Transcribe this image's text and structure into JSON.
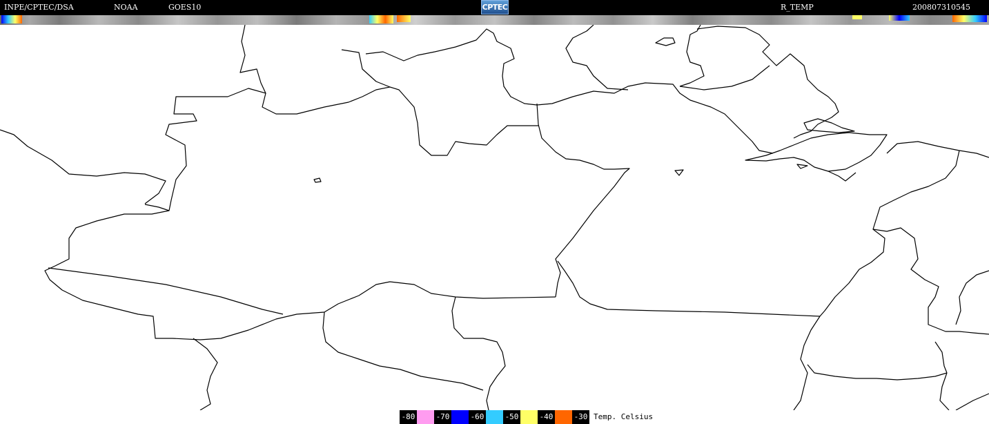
{
  "header": {
    "org": "INPE/CPTEC/DSA",
    "agency": "NOAA",
    "satellite": "GOES10",
    "logo_text": "CPTEC",
    "product": "R_TEMP",
    "timestamp": "200807310545"
  },
  "legend": {
    "unit_label": "Temp. Celsius",
    "items": [
      {
        "label": "-80",
        "color": "#ff9cf0"
      },
      {
        "label": "-70",
        "color": "#0000ff"
      },
      {
        "label": "-60",
        "color": "#33ccff"
      },
      {
        "label": "-50",
        "color": "#ffff66"
      },
      {
        "label": "-40",
        "color": "#ff6600"
      },
      {
        "label": "-30",
        "color": "#ffffff"
      }
    ]
  },
  "colors": {
    "background": "#ffffff",
    "borders": "#000000",
    "header_bg": "#000000"
  },
  "icons": {
    "logo": "cptec-logo-icon"
  }
}
